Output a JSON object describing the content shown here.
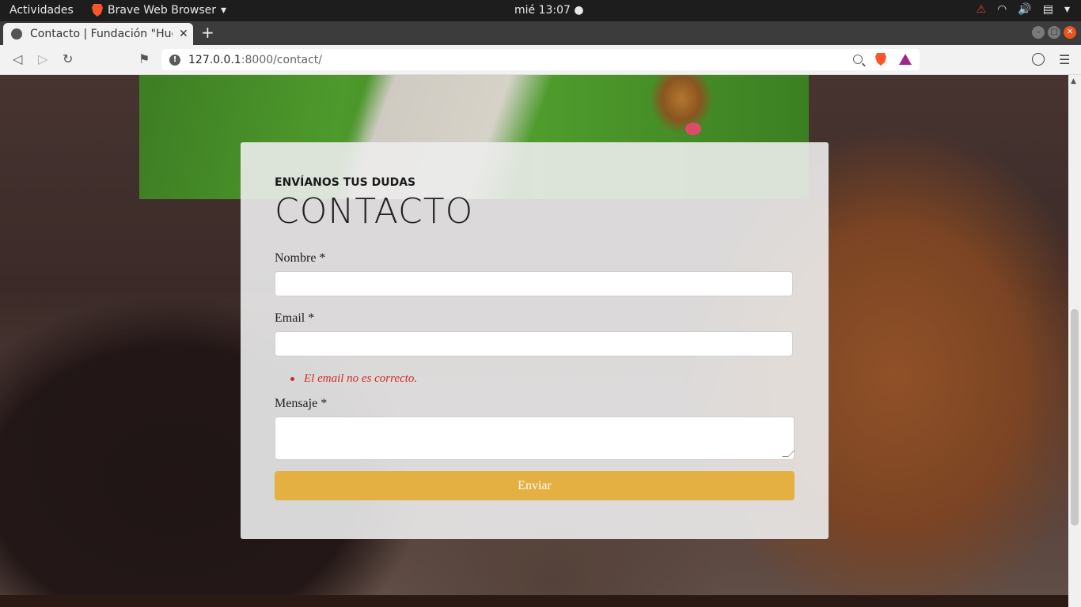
{
  "system_bar": {
    "activities": "Actividades",
    "app_name": "Brave Web Browser",
    "clock": "mié 13:07"
  },
  "browser": {
    "tab_title": "Contacto | Fundación \"Hue",
    "url_host": "127.0.0.1",
    "url_path": ":8000/contact/"
  },
  "page": {
    "eyebrow": "ENVÍANOS TUS DUDAS",
    "heading": "CONTACTO",
    "form": {
      "name_label": "Nombre *",
      "email_label": "Email *",
      "email_error": "El email no es correcto.",
      "message_label": "Mensaje *",
      "submit_label": "Enviar"
    }
  },
  "colors": {
    "accent_button": "#e4b041",
    "error": "#d42828"
  }
}
